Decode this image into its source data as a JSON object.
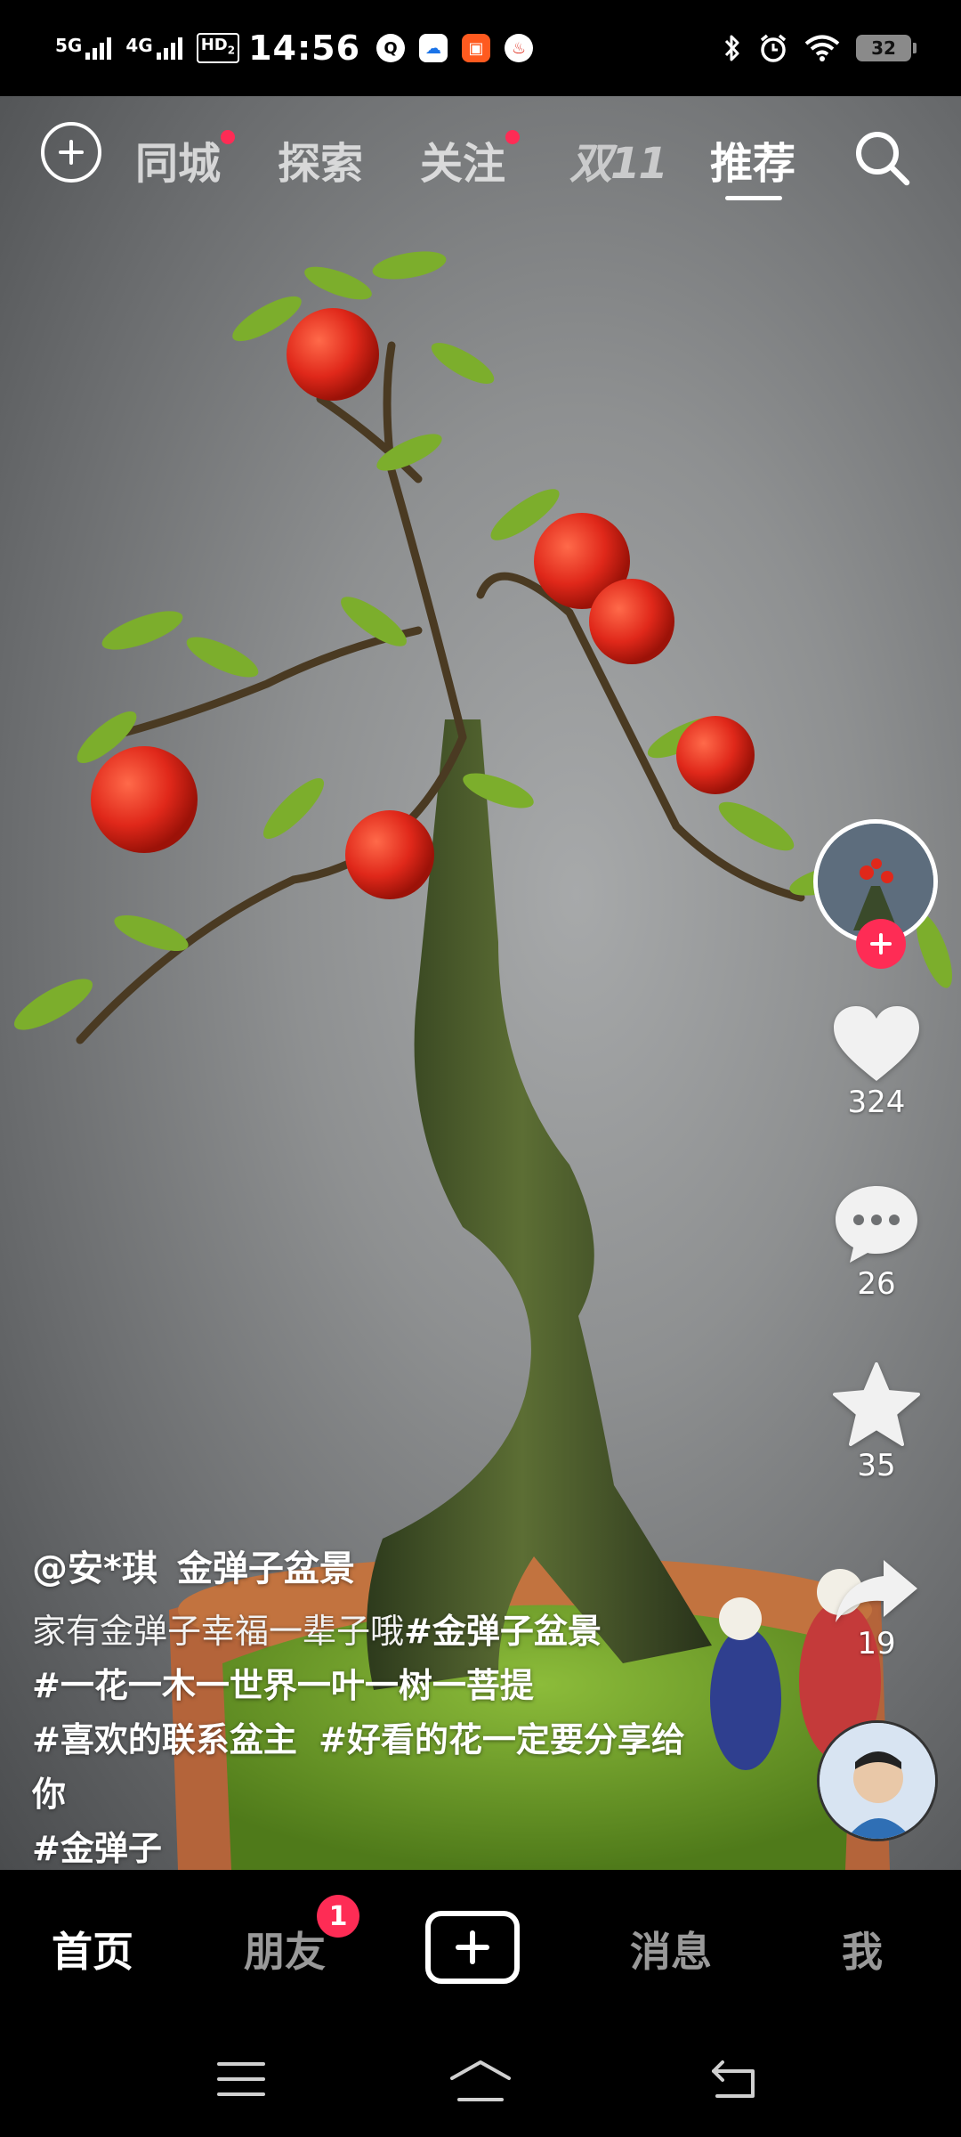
{
  "status_bar": {
    "signal_1": "5G",
    "signal_2": "4G",
    "hd": "HD",
    "hd_sub": "2",
    "time": "14:56",
    "battery": "32",
    "icons": [
      "qq-icon",
      "cloud-app-icon",
      "taobao-icon",
      "fire-icon",
      "bluetooth-icon",
      "alarm-icon",
      "wifi-icon",
      "battery-icon"
    ]
  },
  "top_nav": {
    "tabs": [
      {
        "label": "同城",
        "dot": true
      },
      {
        "label": "探索",
        "dot": false
      },
      {
        "label": "关注",
        "dot": true
      },
      {
        "label": "双11",
        "dot": false
      },
      {
        "label": "推荐",
        "dot": false,
        "active": true
      }
    ]
  },
  "actions": {
    "likes": "324",
    "comments": "26",
    "favorites": "35",
    "shares": "19"
  },
  "caption": {
    "author": "@安*琪",
    "title": "金弹子盆景",
    "text": "家有金弹子幸福一辈子哦",
    "hashtags": [
      "#金弹子盆景",
      "#一花一木一世界一叶一树一菩提",
      "#喜欢的联系盆主",
      "#好看的花一定要分享给你",
      "#金弹子"
    ]
  },
  "bottom_nav": {
    "home": "首页",
    "friends": "朋友",
    "friends_badge": "1",
    "messages": "消息",
    "me": "我"
  },
  "colors": {
    "accent": "#fe2c55",
    "nav_bg": "#000000"
  }
}
